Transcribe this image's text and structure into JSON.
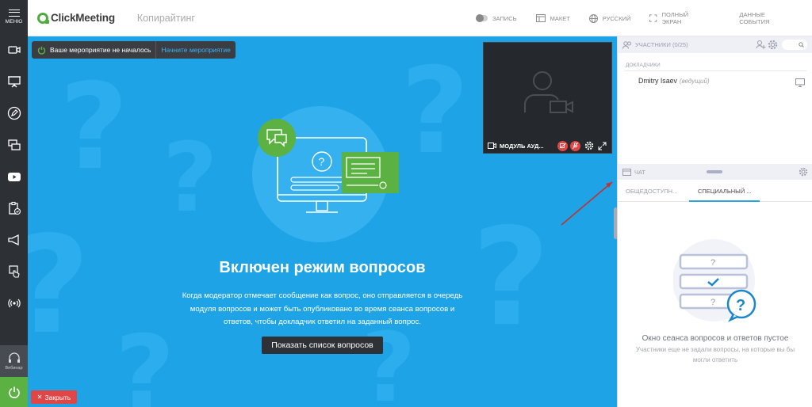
{
  "sidebar": {
    "menu_label": "МЕНЮ",
    "webinar_label": "Вебинар"
  },
  "topbar": {
    "logo": "ClickMeeting",
    "event_title": "Копирайтинг",
    "record": "ЗАПИСЬ",
    "layout": "МАКЕТ",
    "language": "РУССКИЙ",
    "fullscreen": "ПОЛНЫЙ ЭКРАН",
    "event_data": "ДАННЫЕ СОБЫТИЯ"
  },
  "stage": {
    "status_text": "Ваше мероприятие не началось",
    "start_link": "Начните мероприятие",
    "headline": "Включен режим вопросов",
    "description": "Когда модератор отмечает сообщение как вопрос, оно отправляется в очередь модуля вопросов и может быть опубликовано во время сеанса вопросов и ответов, чтобы докладчик ответил на заданный вопрос.",
    "show_questions": "Показать список вопросов",
    "close": "Закрыть",
    "video_module_label": "МОДУЛЬ АУД..."
  },
  "participants": {
    "title": "УЧАСТНИКИ (0/25)",
    "section": "докладчики",
    "presenter_name": "Dmitry Isaev",
    "presenter_role": "(ведущий)"
  },
  "chat": {
    "title": "ЧАТ",
    "tabs": [
      "ОБЩЕДОСТУПН...",
      "СПЕЦИАЛЬНЫЙ ..."
    ],
    "empty_title": "Окно сеанса вопросов и ответов пустое",
    "empty_subtitle": "Участники еще не задали вопросы, на которые вы бы могли ответить"
  },
  "colors": {
    "stage_blue": "#1ea3e7",
    "accent_green": "#5bb142",
    "close_red": "#e14646",
    "sidebar_dark": "#2d3035"
  }
}
